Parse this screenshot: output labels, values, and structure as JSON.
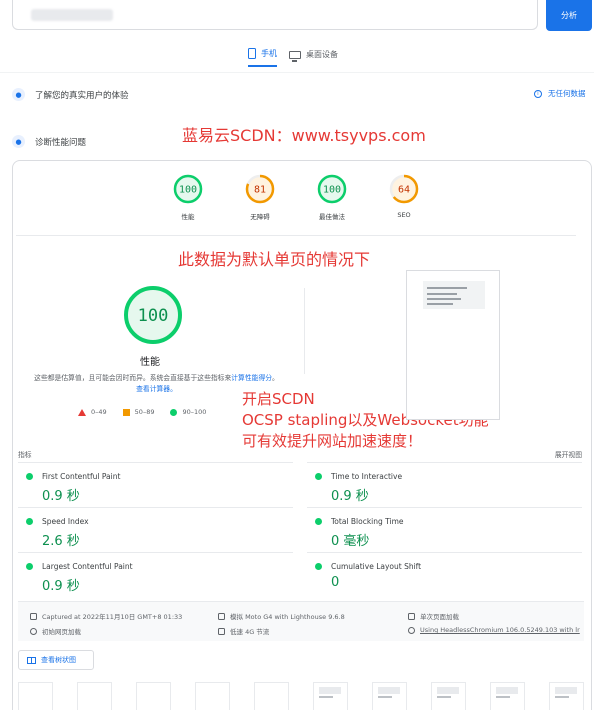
{
  "header": {
    "analyze_label": "分析"
  },
  "tabs": [
    {
      "label": "手机",
      "icon": "phone-icon",
      "active": true
    },
    {
      "label": "桌面设备",
      "icon": "desktop-icon",
      "active": false
    }
  ],
  "sections": {
    "real_users": "了解您的真实用户的体验",
    "no_data": "无任何数据",
    "diagnose": "诊断性能问题"
  },
  "overlay": {
    "title": "蓝易云SCDN：www.tsyvps.com",
    "mid": "此数据为默认单页的情况下",
    "line1": "开启SCDN",
    "line2": "OCSP stapling以及Websocket功能",
    "line3": "可有效提升网站加速速度！"
  },
  "scores": [
    {
      "value": "100",
      "label": "性能",
      "color": "#0cce6b",
      "fraction": 1.0
    },
    {
      "value": "81",
      "label": "无障碍",
      "color": "#f29900",
      "fraction": 0.81
    },
    {
      "value": "100",
      "label": "最佳做法",
      "color": "#0cce6b",
      "fraction": 1.0
    },
    {
      "value": "64",
      "label": "SEO",
      "color": "#f29900",
      "fraction": 0.64
    }
  ],
  "performance": {
    "score": "100",
    "label": "性能",
    "desc_prefix": "这些都是估算值，且可能会因时而异。系统会直接基于这些指标来",
    "desc_link1": "计算性能得分",
    "desc_sep": "。",
    "desc_link2": "查看计算器。"
  },
  "legend": [
    {
      "label": "0–49",
      "shape": "triangle",
      "color": "#e53935"
    },
    {
      "label": "50–89",
      "shape": "square",
      "color": "#f29900"
    },
    {
      "label": "90–100",
      "shape": "circle",
      "color": "#0cce6b"
    }
  ],
  "metrics_header": {
    "left": "指标",
    "right": "展开视图"
  },
  "metrics": [
    {
      "name": "First Contentful Paint",
      "value": "0.9 秒"
    },
    {
      "name": "Time to Interactive",
      "value": "0.9 秒"
    },
    {
      "name": "Speed Index",
      "value": "2.6 秒"
    },
    {
      "name": "Total Blocking Time",
      "value": "0 毫秒"
    },
    {
      "name": "Largest Contentful Paint",
      "value": "0.9 秒"
    },
    {
      "name": "Cumulative Layout Shift",
      "value": "0"
    }
  ],
  "run_info": {
    "captured": "Captured at 2022年11月10日 GMT+8 01:33",
    "device": "模拟 Moto G4 with Lighthouse 9.6.8",
    "load": "单次页面加载",
    "initial": "初始网页加载",
    "throttle": "低速 4G 节流",
    "browser": "Using HeadlessChromium 106.0.5249.103 with lr"
  },
  "treemap_label": "查看树状图"
}
